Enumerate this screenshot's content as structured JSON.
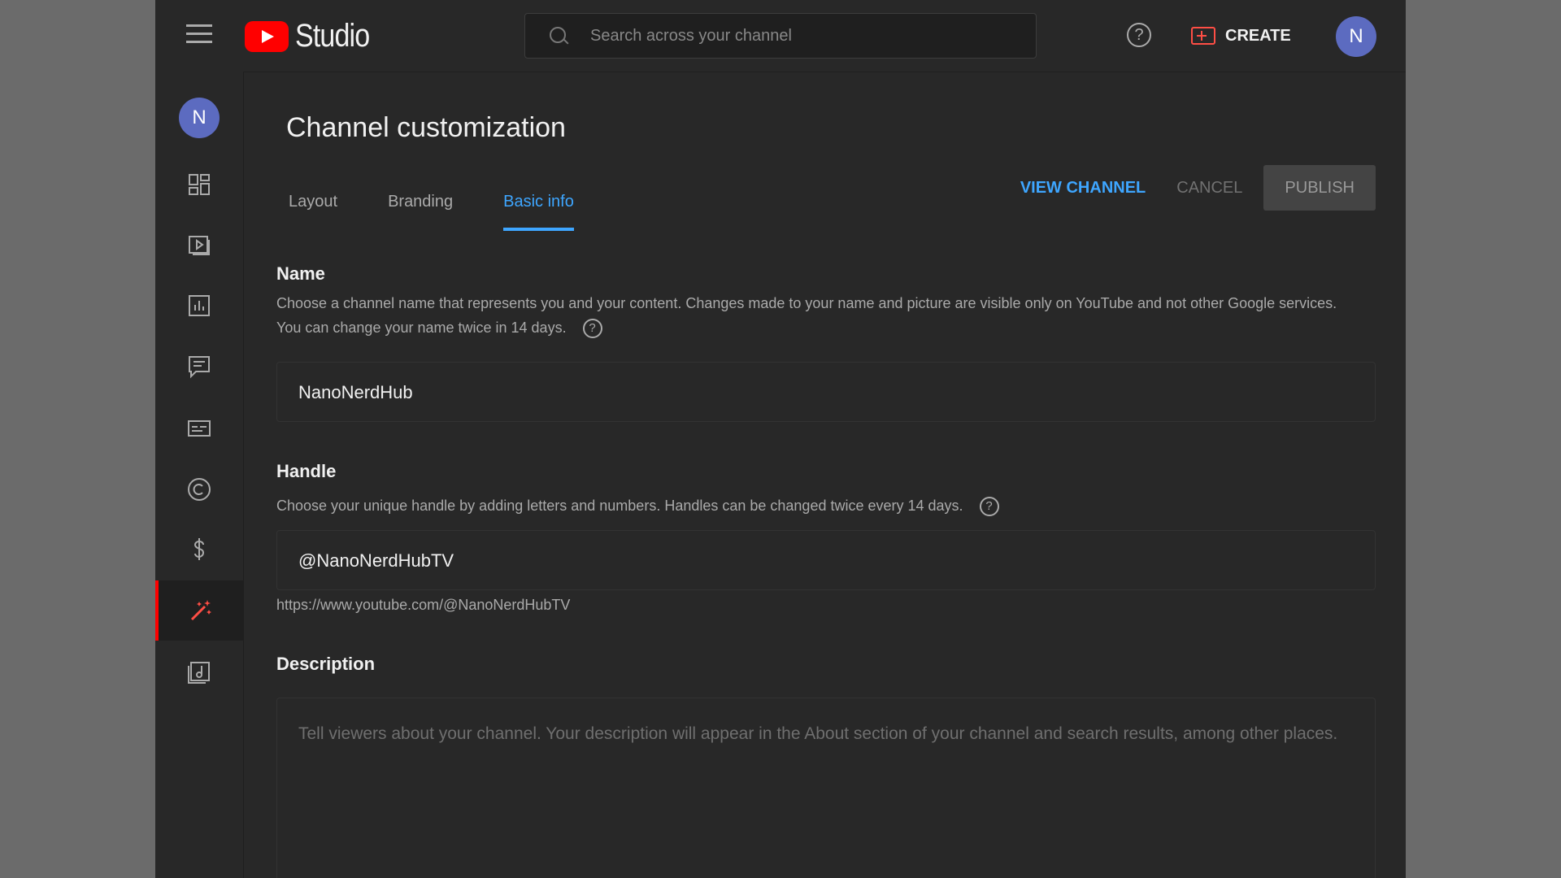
{
  "app": {
    "brand": "Studio",
    "search_placeholder": "Search across your channel",
    "help_icon": "?",
    "create_label": "CREATE",
    "avatar_letter": "N"
  },
  "sidebar": {
    "avatar_letter": "N",
    "items": [
      {
        "name": "dashboard",
        "icon": "dashboard-icon"
      },
      {
        "name": "content",
        "icon": "video-icon"
      },
      {
        "name": "analytics",
        "icon": "analytics-icon"
      },
      {
        "name": "comments",
        "icon": "comments-icon"
      },
      {
        "name": "subtitles",
        "icon": "subtitles-icon"
      },
      {
        "name": "copyright",
        "icon": "copyright-icon"
      },
      {
        "name": "earn",
        "icon": "dollar-icon"
      },
      {
        "name": "customization",
        "icon": "magic-wand-icon",
        "active": true
      },
      {
        "name": "audio-library",
        "icon": "audio-library-icon"
      }
    ],
    "accent": "#ff0000"
  },
  "page": {
    "title": "Channel customization",
    "tabs": [
      {
        "label": "Layout"
      },
      {
        "label": "Branding"
      },
      {
        "label": "Basic info",
        "active": true
      }
    ],
    "actions": {
      "view_channel": "VIEW CHANNEL",
      "cancel": "CANCEL",
      "publish": "PUBLISH"
    }
  },
  "name_section": {
    "label": "Name",
    "description": "Choose a channel name that represents you and your content. Changes made to your name and picture are visible only on YouTube and not other Google services. You can change your name twice in 14 days.",
    "value": "NanoNerdHub"
  },
  "handle_section": {
    "label": "Handle",
    "description": "Choose your unique handle by adding letters and numbers. Handles can be changed twice every 14 days.",
    "value": "@NanoNerdHubTV",
    "url": "https://www.youtube.com/@NanoNerdHubTV"
  },
  "description_section": {
    "label": "Description",
    "placeholder": "Tell viewers about your channel. Your description will appear in the About section of your channel and search results, among other places."
  },
  "colors": {
    "accent_blue": "#3ea6ff",
    "brand_red": "#ff0000",
    "background": "#282828"
  }
}
